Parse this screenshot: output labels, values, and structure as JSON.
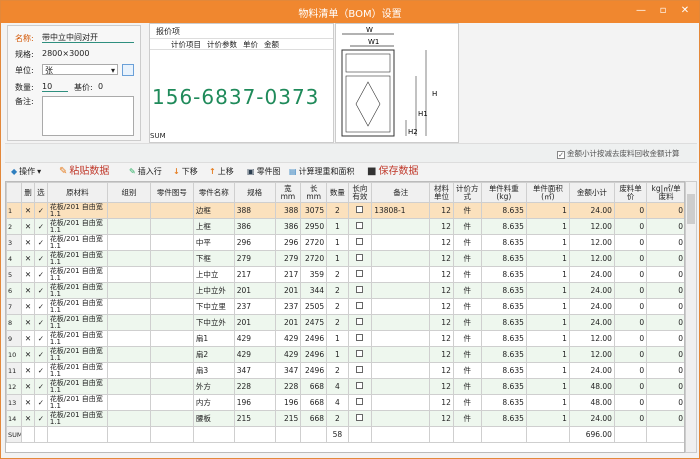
{
  "window": {
    "title": "物料清单（BOM）设置",
    "minimize": "—",
    "restore": "▫",
    "close": "✕"
  },
  "props": {
    "name_label": "名称:",
    "name_value": "带中立中间对开",
    "spec_label": "规格:",
    "spec_value": "2800×3000",
    "unit_label": "单位:",
    "unit_value": "张",
    "qty_label": "数量:",
    "qty_value": "10",
    "base_label": "基价:",
    "base_value": "0",
    "note_label": "备注:"
  },
  "quote": {
    "header": "报价项",
    "cols": [
      "计价项目",
      "计价参数",
      "单价",
      "金额"
    ],
    "sum_label": "SUM",
    "phone": "156-6837-0373"
  },
  "drawing": {
    "w": "W",
    "w1": "W1",
    "h": "H",
    "h1": "H1",
    "h2": "H2"
  },
  "options": {
    "amount_checkbox": "金额小计按减去废料回收金额计算"
  },
  "toolbar": {
    "operate": "操作",
    "paste": "粘贴数据",
    "insert": "插入行",
    "down": "下移",
    "up": "上移",
    "parts": "零件图",
    "calc": "计算理重和面积",
    "save": "保存数据"
  },
  "table": {
    "headers": [
      "删",
      "选",
      "原材料",
      "组别",
      "零件图号",
      "零件名称",
      "规格",
      "宽mm",
      "长mm",
      "数量",
      "长向有效",
      "备注",
      "材料单位",
      "计价方式",
      "单件料重(kg)",
      "单件面积(㎡)",
      "金额小计",
      "废料单价",
      "kg|㎡/单废料"
    ],
    "rows": [
      {
        "rn": "1",
        "mat": "花板/201 自由宽1.1",
        "name": "边框",
        "spec": "388",
        "w": "388",
        "l": "3075",
        "qty": "2",
        "note": "13808-1",
        "unit": "12",
        "pm": "件",
        "wt": "8.635",
        "area": "1",
        "amt": "24.00",
        "sp": "0",
        "sw": "0"
      },
      {
        "rn": "2",
        "mat": "花板/201 自由宽1.1",
        "name": "上框",
        "spec": "386",
        "w": "386",
        "l": "2950",
        "qty": "1",
        "note": "",
        "unit": "12",
        "pm": "件",
        "wt": "8.635",
        "area": "1",
        "amt": "12.00",
        "sp": "0",
        "sw": "0"
      },
      {
        "rn": "3",
        "mat": "花板/201 自由宽1.1",
        "name": "中平",
        "spec": "296",
        "w": "296",
        "l": "2720",
        "qty": "1",
        "note": "",
        "unit": "12",
        "pm": "件",
        "wt": "8.635",
        "area": "1",
        "amt": "12.00",
        "sp": "0",
        "sw": "0"
      },
      {
        "rn": "4",
        "mat": "花板/201 自由宽1.1",
        "name": "下框",
        "spec": "279",
        "w": "279",
        "l": "2720",
        "qty": "1",
        "note": "",
        "unit": "12",
        "pm": "件",
        "wt": "8.635",
        "area": "1",
        "amt": "12.00",
        "sp": "0",
        "sw": "0"
      },
      {
        "rn": "5",
        "mat": "花板/201 自由宽1.1",
        "name": "上中立",
        "spec": "217",
        "w": "217",
        "l": "359",
        "qty": "2",
        "note": "",
        "unit": "12",
        "pm": "件",
        "wt": "8.635",
        "area": "1",
        "amt": "24.00",
        "sp": "0",
        "sw": "0"
      },
      {
        "rn": "6",
        "mat": "花板/201 自由宽1.1",
        "name": "上中立外",
        "spec": "201",
        "w": "201",
        "l": "344",
        "qty": "2",
        "note": "",
        "unit": "12",
        "pm": "件",
        "wt": "8.635",
        "area": "1",
        "amt": "24.00",
        "sp": "0",
        "sw": "0"
      },
      {
        "rn": "7",
        "mat": "花板/201 自由宽1.1",
        "name": "下中立里",
        "spec": "237",
        "w": "237",
        "l": "2505",
        "qty": "2",
        "note": "",
        "unit": "12",
        "pm": "件",
        "wt": "8.635",
        "area": "1",
        "amt": "24.00",
        "sp": "0",
        "sw": "0"
      },
      {
        "rn": "8",
        "mat": "花板/201 自由宽1.1",
        "name": "下中立外",
        "spec": "201",
        "w": "201",
        "l": "2475",
        "qty": "2",
        "note": "",
        "unit": "12",
        "pm": "件",
        "wt": "8.635",
        "area": "1",
        "amt": "24.00",
        "sp": "0",
        "sw": "0"
      },
      {
        "rn": "9",
        "mat": "花板/201 自由宽1.1",
        "name": "扇1",
        "spec": "429",
        "w": "429",
        "l": "2496",
        "qty": "1",
        "note": "",
        "unit": "12",
        "pm": "件",
        "wt": "8.635",
        "area": "1",
        "amt": "12.00",
        "sp": "0",
        "sw": "0"
      },
      {
        "rn": "10",
        "mat": "花板/201 自由宽1.1",
        "name": "扇2",
        "spec": "429",
        "w": "429",
        "l": "2496",
        "qty": "1",
        "note": "",
        "unit": "12",
        "pm": "件",
        "wt": "8.635",
        "area": "1",
        "amt": "12.00",
        "sp": "0",
        "sw": "0"
      },
      {
        "rn": "11",
        "mat": "花板/201 自由宽1.1",
        "name": "扇3",
        "spec": "347",
        "w": "347",
        "l": "2496",
        "qty": "2",
        "note": "",
        "unit": "12",
        "pm": "件",
        "wt": "8.635",
        "area": "1",
        "amt": "24.00",
        "sp": "0",
        "sw": "0"
      },
      {
        "rn": "12",
        "mat": "花板/201 自由宽1.1",
        "name": "外方",
        "spec": "228",
        "w": "228",
        "l": "668",
        "qty": "4",
        "note": "",
        "unit": "12",
        "pm": "件",
        "wt": "8.635",
        "area": "1",
        "amt": "48.00",
        "sp": "0",
        "sw": "0"
      },
      {
        "rn": "13",
        "mat": "花板/201 自由宽1.1",
        "name": "内方",
        "spec": "196",
        "w": "196",
        "l": "668",
        "qty": "4",
        "note": "",
        "unit": "12",
        "pm": "件",
        "wt": "8.635",
        "area": "1",
        "amt": "48.00",
        "sp": "0",
        "sw": "0"
      },
      {
        "rn": "14",
        "mat": "花板/201 自由宽1.1",
        "name": "腰板",
        "spec": "215",
        "w": "215",
        "l": "668",
        "qty": "2",
        "note": "",
        "unit": "12",
        "pm": "件",
        "wt": "8.635",
        "area": "1",
        "amt": "24.00",
        "sp": "0",
        "sw": "0"
      }
    ],
    "sum_label": "SUM",
    "sum_qty": "58",
    "sum_amt": "696.00"
  },
  "colors": {
    "accent": "#f0872f",
    "selected_row": "#fbe1bd"
  }
}
